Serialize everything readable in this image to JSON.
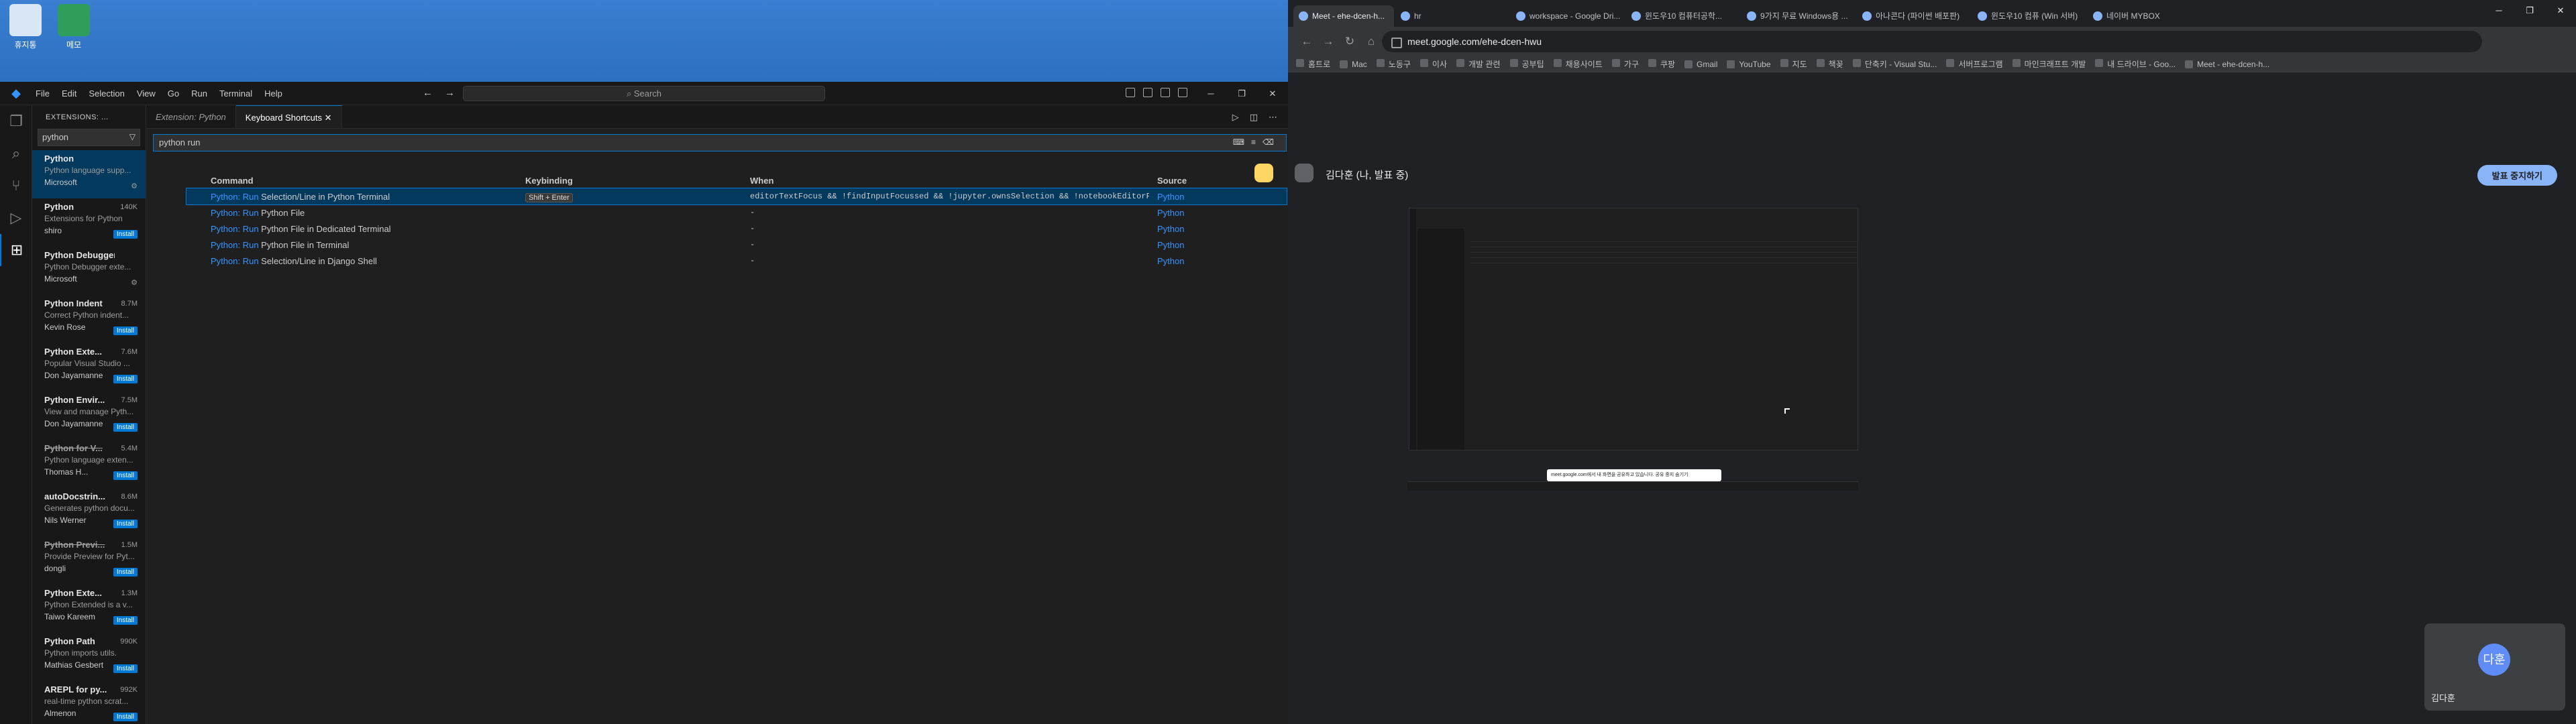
{
  "desktop": {
    "icons": [
      "휴지통",
      "메모"
    ]
  },
  "vscode": {
    "menu": [
      "File",
      "Edit",
      "Selection",
      "View",
      "Go",
      "Run",
      "Terminal",
      "Help"
    ],
    "search_placeholder": "Search",
    "sidebar_title": "EXTENSIONS: ...",
    "sidebar_search": "python",
    "extensions": [
      {
        "name": "Python",
        "desc": "Python language supp...",
        "publisher": "Microsoft",
        "downloads": "",
        "installed": true,
        "deprecated": false,
        "selected": true
      },
      {
        "name": "Python",
        "desc": "Extensions for Python",
        "publisher": "shiro",
        "downloads": "140K",
        "installed": false,
        "deprecated": false,
        "selected": false
      },
      {
        "name": "Python Debugger",
        "desc": "Python Debugger exte...",
        "publisher": "Microsoft",
        "downloads": "",
        "installed": true,
        "deprecated": false,
        "selected": false
      },
      {
        "name": "Python Indent",
        "desc": "Correct Python indent...",
        "publisher": "Kevin Rose",
        "downloads": "8.7M",
        "installed": false,
        "deprecated": false,
        "selected": false
      },
      {
        "name": "Python Exte...",
        "desc": "Popular Visual Studio ...",
        "publisher": "Don Jayamanne",
        "downloads": "7.6M",
        "installed": false,
        "deprecated": false,
        "selected": false
      },
      {
        "name": "Python Envir...",
        "desc": "View and manage Pyth...",
        "publisher": "Don Jayamanne",
        "downloads": "7.5M",
        "installed": false,
        "deprecated": false,
        "selected": false
      },
      {
        "name": "Python for V...",
        "desc": "Python language exten...",
        "publisher": "Thomas H...",
        "downloads": "5.4M",
        "installed": false,
        "deprecated": true,
        "selected": false
      },
      {
        "name": "autoDocstrin...",
        "desc": "Generates python docu...",
        "publisher": "Nils Werner",
        "downloads": "8.6M",
        "installed": false,
        "deprecated": false,
        "selected": false
      },
      {
        "name": "Python Previ...",
        "desc": "Provide Preview for Pyt...",
        "publisher": "dongli",
        "downloads": "1.5M",
        "installed": false,
        "deprecated": true,
        "selected": false
      },
      {
        "name": "Python Exte...",
        "desc": "Python Extended is a v...",
        "publisher": "Taiwo Kareem",
        "downloads": "1.3M",
        "installed": false,
        "deprecated": false,
        "selected": false
      },
      {
        "name": "Python Path",
        "desc": "Python imports utils.",
        "publisher": "Mathias Gesbert",
        "downloads": "990K",
        "installed": false,
        "deprecated": false,
        "selected": false
      },
      {
        "name": "AREPL for py...",
        "desc": "real-time python scrat...",
        "publisher": "Almenon",
        "downloads": "992K",
        "installed": false,
        "deprecated": false,
        "selected": false
      }
    ],
    "install_label": "Install",
    "tabs": [
      "Extension: Python",
      "Keyboard Shortcuts"
    ],
    "keybinding_search": "python run",
    "columns": {
      "command": "Command",
      "keybinding": "Keybinding",
      "when": "When",
      "source": "Source"
    },
    "rows": [
      {
        "prefix": "Python: Run",
        "rest": " Selection/Line in Python Terminal",
        "key": "Shift + Enter",
        "when": "editorTextFocus && !findInputFocussed && !jupyter.ownsSelection && !notebookEditorFocuss...",
        "source": "Python"
      },
      {
        "prefix": "Python: Run",
        "rest": " Python File",
        "key": "",
        "when": "-",
        "source": "Python"
      },
      {
        "prefix": "Python: Run",
        "rest": " Python File in Dedicated Terminal",
        "key": "",
        "when": "-",
        "source": "Python"
      },
      {
        "prefix": "Python: Run",
        "rest": " Python File in Terminal",
        "key": "",
        "when": "-",
        "source": "Python"
      },
      {
        "prefix": "Python: Run",
        "rest": " Selection/Line in Django Shell",
        "key": "",
        "when": "-",
        "source": "Python"
      }
    ]
  },
  "chrome": {
    "tabs": [
      "Meet - ehe-dcen-h...",
      "hr",
      "workspace - Google Dri...",
      "윈도우10 컴퓨터공학...",
      "9가지 무료 Windows용 ...",
      "아나콘다 (파이썬 배포판)",
      "윈도우10 컴퓨 (Win 서버)",
      "네이버 MYBOX"
    ],
    "url": "meet.google.com/ehe-dcen-hwu",
    "bookmarks": [
      "홈트로",
      "Mac",
      "노동구",
      "이사",
      "개발 관련",
      "공부팁",
      "채용사이트",
      "가구",
      "쿠팡",
      "Gmail",
      "YouTube",
      "지도",
      "책꽂",
      "단축키 - Visual Stu...",
      "서버프로그램",
      "마인크래프트 개발",
      "내 드라이브 - Goo...",
      "Meet - ehe-dcen-h..."
    ],
    "presenter": "김다훈 (나, 발표 중)",
    "stop_label": "발표 중지하기",
    "self_name": "김다훈",
    "avatar_text": "다훈",
    "toast": "meet.google.com에서 내 화면을 공유하고 있습니다.   공유 중지   숨기기"
  }
}
